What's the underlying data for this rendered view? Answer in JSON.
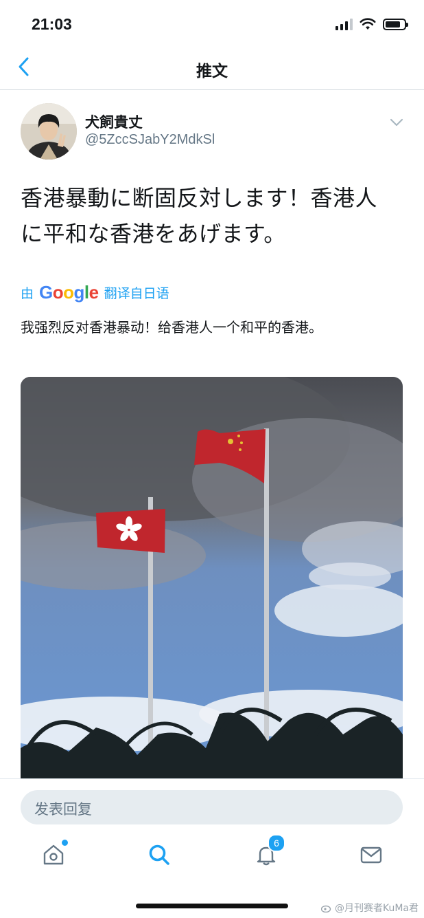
{
  "status_bar": {
    "time": "21:03",
    "battery_level": 0.7
  },
  "nav": {
    "title": "推文",
    "back_icon": "chevron-left-icon"
  },
  "tweet": {
    "author_name": "犬飼貴丈",
    "author_handle": "@5ZccSJabY2MdkSl",
    "text_line1": "香港暴動に断固反対します！香港人",
    "text_line2": "に平和な香港をあげます。",
    "translate_prefix": "由",
    "translate_brand": "Google",
    "translate_suffix": "翻译自日语",
    "translated_text": "我强烈反对香港暴动！给香港人一个和平的香港。",
    "photo_icon": "flags-photo"
  },
  "reply": {
    "placeholder": "发表回复"
  },
  "tabbar": {
    "tabs": [
      {
        "name": "home",
        "icon": "home-icon",
        "has_dot": true
      },
      {
        "name": "search",
        "icon": "search-icon",
        "active": true
      },
      {
        "name": "notifications",
        "icon": "bell-icon",
        "badge": "6"
      },
      {
        "name": "messages",
        "icon": "mail-icon"
      }
    ]
  },
  "watermark": "@月刊赛者KuMa君",
  "colors": {
    "accent": "#1da1f2",
    "text": "#14171a",
    "secondary": "#657786"
  }
}
